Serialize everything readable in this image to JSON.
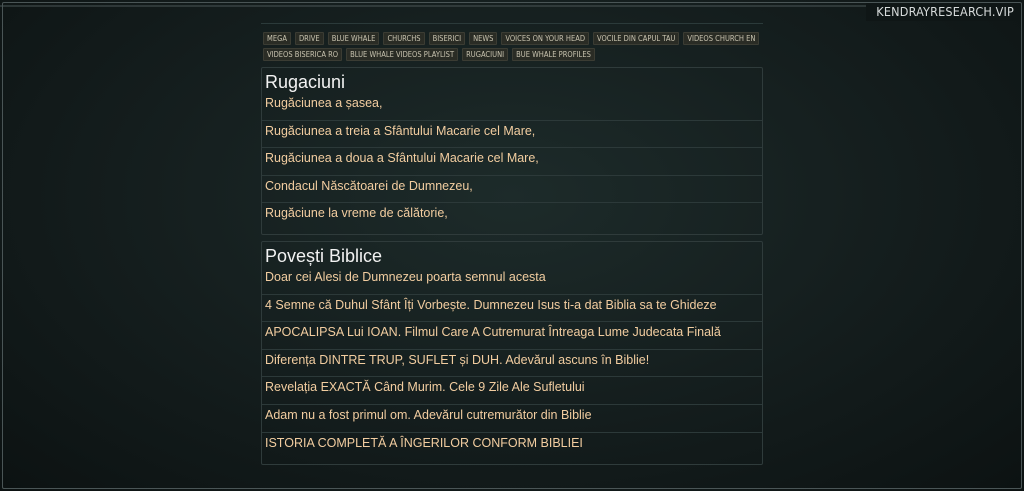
{
  "brand": {
    "text": "KENDRAYRESEARCH.VIP"
  },
  "nav": {
    "tags": [
      "MEGA",
      "DRIVE",
      "BLUE WHALE",
      "CHURCHS",
      "BISERICI",
      "NEWS",
      "VOICES ON YOUR HEAD",
      "VOCILE DIN CAPUL TAU",
      "VIDEOS CHURCH EN",
      "VIDEOS BISERICA RO",
      "BLUE WHALE VIDEOS PLAYLIST",
      "RUGACIUNI",
      "BUE WHALE PROFILES"
    ]
  },
  "sections": [
    {
      "title": "Rugaciuni",
      "items": [
        "Rugăciunea a șasea,",
        "Rugăciunea a treia a Sfântului Macarie cel Mare,",
        "Rugăciunea a doua a Sfântului Macarie cel Mare,",
        "Condacul Născătoarei de Dumnezeu,",
        "Rugăciune la vreme de călătorie,"
      ]
    },
    {
      "title": "Povești Biblice",
      "items": [
        "Doar cei Alesi de Dumnezeu poarta semnul acesta",
        "4 Semne că Duhul Sfânt Îți Vorbește. Dumnezeu Isus ti-a dat Biblia sa te Ghideze",
        "APOCALIPSA Lui IOAN. Filmul Care A Cutremurat Întreaga Lume Judecata Finală",
        "Diferența DINTRE TRUP, SUFLET și DUH. Adevărul ascuns în Biblie!",
        "Revelația EXACTĂ Când Murim. Cele 9 Zile Ale Sufletului",
        "Adam nu a fost primul om. Adevărul cutremurător din Biblie",
        "ISTORIA COMPLETĂ A ÎNGERILOR CONFORM BIBLIEI"
      ]
    }
  ]
}
